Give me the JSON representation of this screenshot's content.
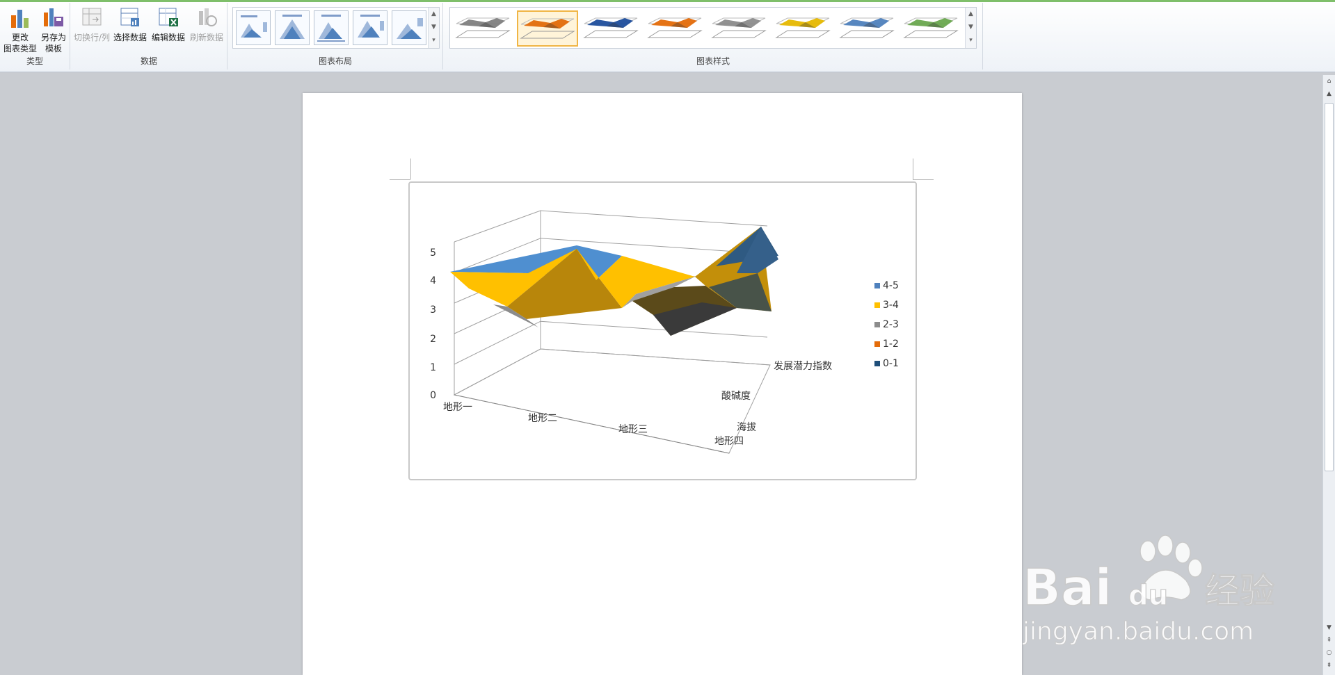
{
  "ribbon": {
    "type_group": {
      "label": "类型",
      "change_type_line1": "更改",
      "change_type_line2": "图表类型",
      "save_template_line1": "另存为",
      "save_template_line2": "模板"
    },
    "data_group": {
      "label": "数据",
      "switch_row_col": "切换行/列",
      "select_data": "选择数据",
      "edit_data": "编辑数据",
      "refresh_data": "刷新数据"
    },
    "layout_group": {
      "label": "图表布局"
    },
    "style_group": {
      "label": "图表样式",
      "styles": [
        {
          "name": "gray",
          "color": "#7f7f7f"
        },
        {
          "name": "orange",
          "color": "#e36c09"
        },
        {
          "name": "blue",
          "color": "#1f4e9c"
        },
        {
          "name": "orange-2",
          "color": "#e46c0a"
        },
        {
          "name": "gray-2",
          "color": "#8c8c8c"
        },
        {
          "name": "gold",
          "color": "#e6b800"
        },
        {
          "name": "sky",
          "color": "#4f81bd"
        },
        {
          "name": "green",
          "color": "#6aa84f"
        }
      ]
    }
  },
  "chart_data": {
    "type": "surface-3d",
    "categories": [
      "地形一",
      "地形二",
      "地形三",
      "地形四"
    ],
    "series_axis": [
      "海拔",
      "酸碱度",
      "发展潜力指数"
    ],
    "z_ticks": [
      "0",
      "1",
      "2",
      "3",
      "4",
      "5"
    ],
    "zlim": [
      0,
      5
    ],
    "legend": [
      {
        "label": "4-5",
        "color": "#4f81bd"
      },
      {
        "label": "3-4",
        "color": "#ffc000"
      },
      {
        "label": "2-3",
        "color": "#8c8c8c"
      },
      {
        "label": "1-2",
        "color": "#e46c0a"
      },
      {
        "label": "0-1",
        "color": "#1f4e79"
      }
    ],
    "legend_position": "right"
  },
  "watermark": {
    "brand": "Bai",
    "brand2": "du",
    "cn": "经验",
    "url": "jingyan.baidu.com"
  }
}
